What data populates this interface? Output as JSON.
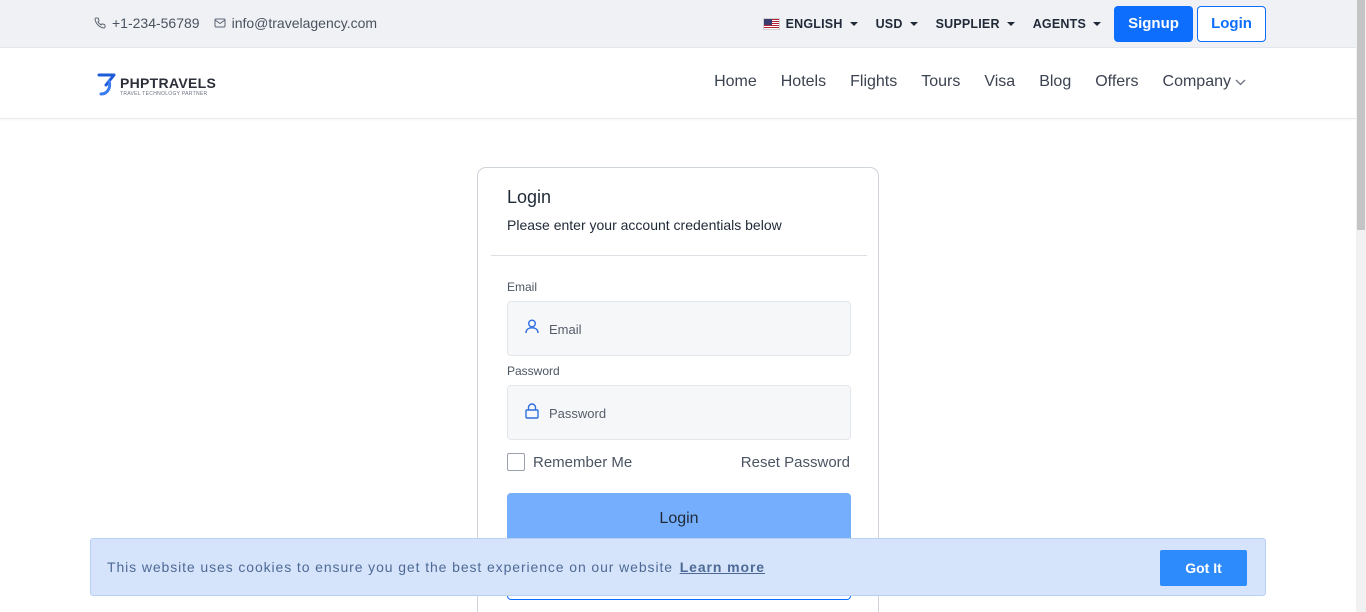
{
  "topbar": {
    "phone": "+1-234-56789",
    "email": "info@travelagency.com",
    "language": "ENGLISH",
    "currency": "USD",
    "supplier": "SUPPLIER",
    "agents": "AGENTS",
    "signup_label": "Signup",
    "login_label": "Login"
  },
  "brand": {
    "name": "PHPTRAVELS",
    "tagline": "TRAVEL TECHNOLOGY PARTNER"
  },
  "nav": {
    "items": [
      {
        "label": "Home"
      },
      {
        "label": "Hotels"
      },
      {
        "label": "Flights"
      },
      {
        "label": "Tours"
      },
      {
        "label": "Visa"
      },
      {
        "label": "Blog"
      },
      {
        "label": "Offers"
      }
    ],
    "company_label": "Company"
  },
  "login_card": {
    "title": "Login",
    "subtitle": "Please enter your account credentials below",
    "email_label": "Email",
    "email_placeholder": "Email",
    "password_label": "Password",
    "password_placeholder": "Password",
    "remember_label": "Remember Me",
    "reset_label": "Reset Password",
    "submit_label": "Login"
  },
  "cookie": {
    "message": "This website uses cookies to ensure you get the best experience on our website",
    "learn_more": "Learn more",
    "accept_label": "Got It"
  },
  "colors": {
    "primary": "#0d6efd",
    "login_button_disabled": "#75aefc",
    "cookie_background": "#d6e4fb",
    "cookie_button": "#2e8bfb",
    "topbar_background": "#f0f1f5"
  },
  "icons": {
    "phone": "phone-icon",
    "mail": "mail-icon",
    "flag": "us-flag-icon",
    "user": "user-icon",
    "lock": "lock-icon",
    "logo": "phptravels-logo-icon"
  }
}
